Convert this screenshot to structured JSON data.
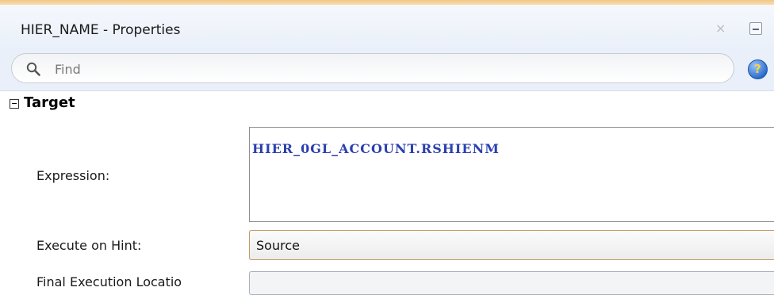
{
  "window": {
    "title": "HIER_NAME - Properties",
    "close_glyph": "×"
  },
  "search": {
    "placeholder": "Find",
    "help_glyph": "?"
  },
  "section": {
    "title": "Target"
  },
  "fields": {
    "expression_label": "Expression:",
    "expression_value": "HIER_0GL_ACCOUNT.RSHIENM",
    "execute_hint_label": "Execute on Hint:",
    "execute_hint_value": "Source",
    "final_execution_label": "Final Execution Locatio"
  },
  "colors": {
    "accent": "#f4c888",
    "expression_text": "#2b3fb0"
  }
}
